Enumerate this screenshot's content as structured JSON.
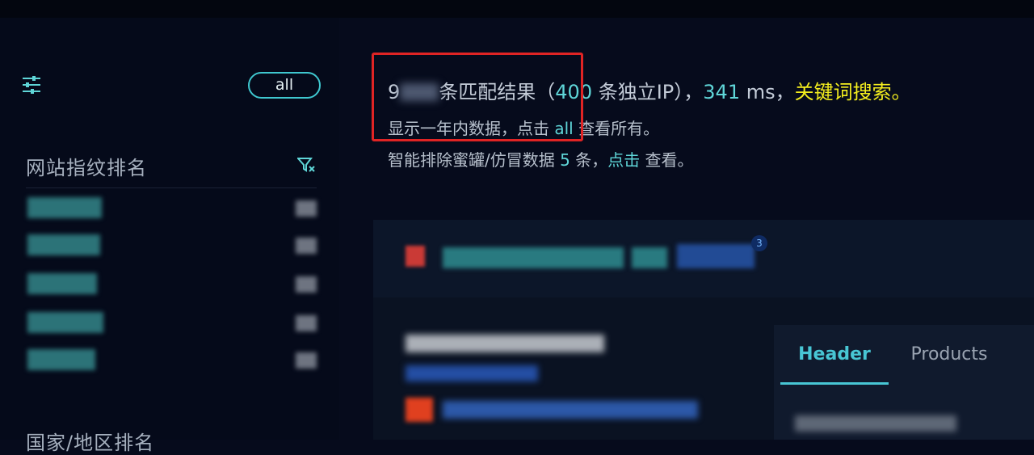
{
  "sidebar": {
    "filter_icon": "sliders-icon",
    "all_button": "all",
    "fingerprint_title": "网站指纹排名",
    "funnel_icon": "filter-funnel-icon",
    "region_title": "国家/地区排名",
    "rank_rows": [
      {
        "label": "[redacted]",
        "count": "[redacted]"
      },
      {
        "label": "[redacted]",
        "count": "[redacted]"
      },
      {
        "label": "[redacted]",
        "count": "[redacted]"
      },
      {
        "label": "[redacted]",
        "count": "[redacted]"
      },
      {
        "label": "[redacted]",
        "count": "[redacted]"
      }
    ]
  },
  "results": {
    "count_prefix": "9",
    "count_mid": "条匹配结果（",
    "unique_ip": "400",
    "unique_suffix": " 条独立IP），",
    "ms_value": "341",
    "ms_suffix": " ms，",
    "keyword_search": "关键词搜索。",
    "line2_prefix": "显示一年内数据，点击 ",
    "line2_link": "all",
    "line2_suffix": " 查看所有。",
    "line3_prefix": "智能排除蜜罐/仿冒数据 ",
    "line3_count": "5",
    "line3_mid": " 条，",
    "line3_link": "点击",
    "line3_suffix": " 查看。"
  },
  "card": {
    "badge_count": "3",
    "tabs": [
      "Header",
      "Products"
    ]
  },
  "colors": {
    "accent_cyan": "#5fd6d8",
    "highlight_yellow": "#f4ee1e",
    "annotation_red": "#e02424",
    "background": "#060b1c"
  }
}
